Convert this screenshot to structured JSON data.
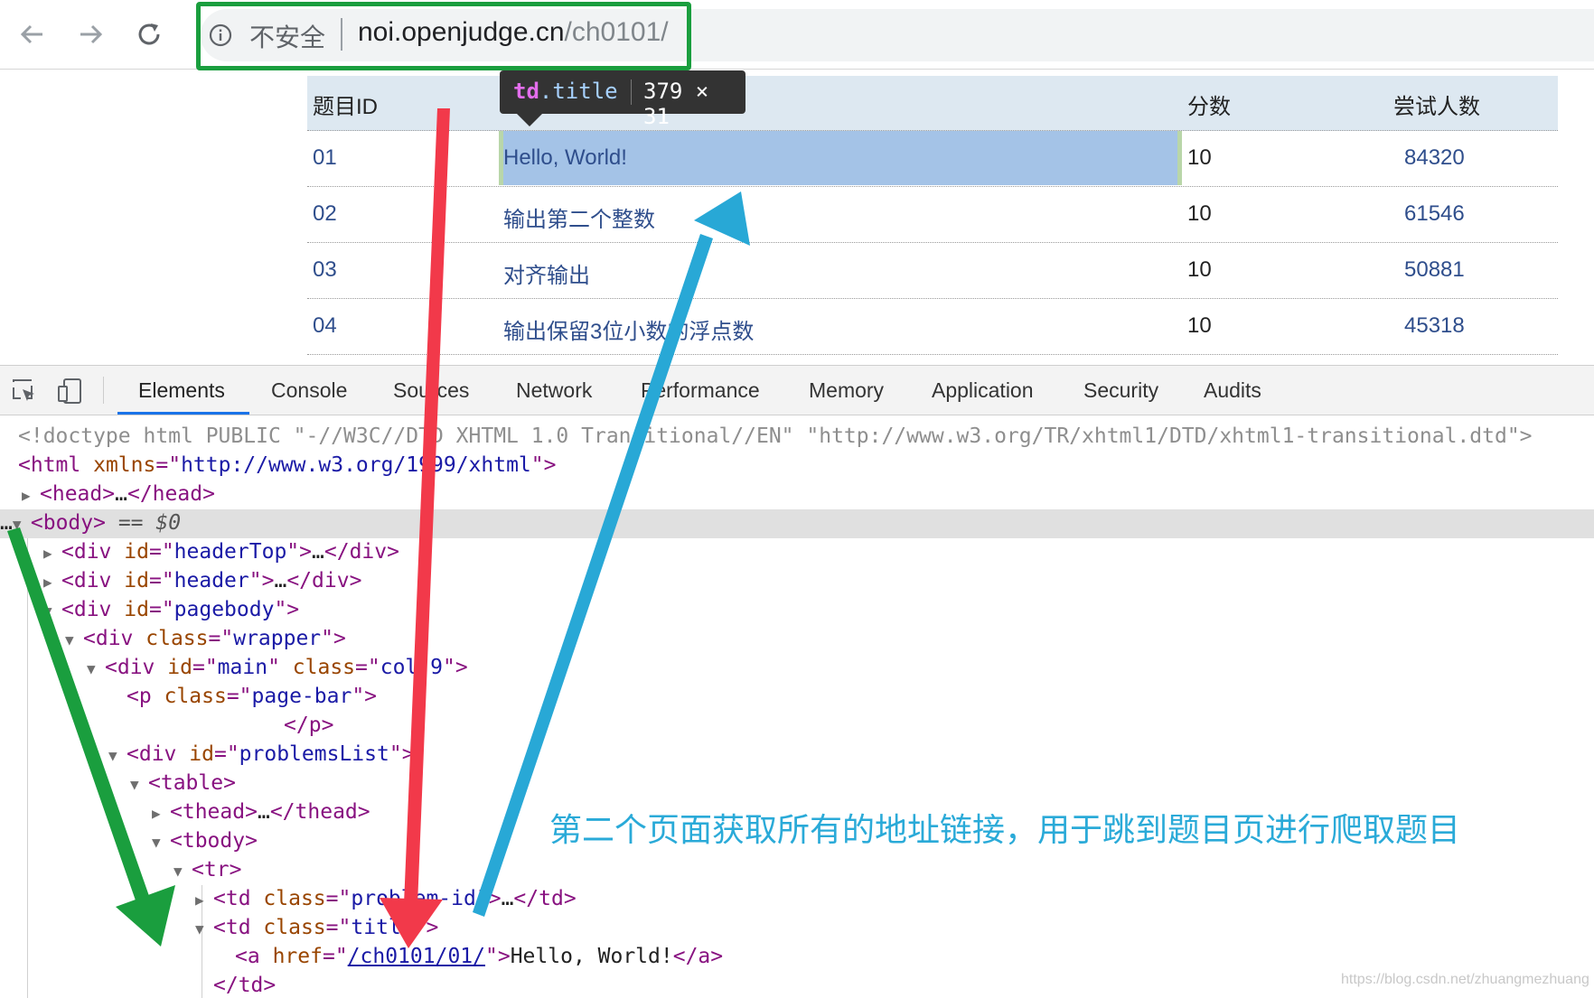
{
  "browser": {
    "security_label": "不安全",
    "url_host": "noi.openjudge.cn",
    "url_path": "/ch0101/"
  },
  "table": {
    "headers": [
      "题目ID",
      "分数",
      "尝试人数"
    ],
    "rows": [
      {
        "id": "01",
        "title": "Hello, World!",
        "score": "10",
        "tried": "84320"
      },
      {
        "id": "02",
        "title": "输出第二个整数",
        "score": "10",
        "tried": "61546"
      },
      {
        "id": "03",
        "title": "对齐输出",
        "score": "10",
        "tried": "50881"
      },
      {
        "id": "04",
        "title": "输出保留3位小数的浮点数",
        "score": "10",
        "tried": "45318"
      }
    ]
  },
  "tooltip": {
    "tag": "td",
    "cls": ".title",
    "dims": "379 × 31"
  },
  "devtools": {
    "tabs": [
      "Elements",
      "Console",
      "Sources",
      "Network",
      "Performance",
      "Memory",
      "Application",
      "Security",
      "Audits"
    ],
    "dom": {
      "doctype": "<!doctype html PUBLIC \"-//W3C//DTD XHTML 1.0 Transitional//EN\" \"http://www.w3.org/TR/xhtml1/DTD/xhtml1-transitional.dtd\">",
      "html_xmlns": "http://www.w3.org/1999/xhtml",
      "body_marker": "== $0",
      "ellipsis": "…",
      "header_top_id": "headerTop",
      "header_id": "header",
      "pagebody_id": "pagebody",
      "wrapper_class": "wrapper",
      "main_id": "main",
      "main_class": "col-9",
      "pagebar_class": "page-bar",
      "problems_list_id": "problemsList",
      "problem_id_class": "problem-id",
      "title_class": "title",
      "link_href": "/ch0101/01/",
      "link_text": "Hello, World!"
    }
  },
  "annotation": "第二个页面获取所有的地址链接，用于跳到题目页进行爬取题目",
  "watermark": "https://blog.csdn.net/zhuangmezhuang",
  "colors": {
    "green_arrow": "#1a9e3e",
    "red_arrow": "#f2394a",
    "blue_arrow": "#28a8d6"
  }
}
